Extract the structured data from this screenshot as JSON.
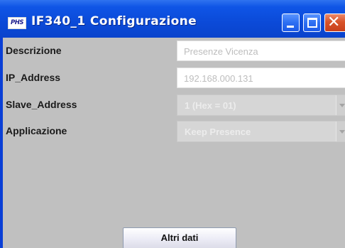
{
  "window": {
    "icon_text": "PHS",
    "title": "IF340_1 Configurazione",
    "buttons": {
      "minimize_icon": "minimize-icon",
      "maximize_icon": "maximize-icon",
      "close_icon": "close-icon",
      "close_glyph": "✕"
    }
  },
  "form": {
    "descrizione": {
      "label": "Descrizione",
      "value": "Presenze Vicenza"
    },
    "ip_address": {
      "label": "IP_Address",
      "value": "192.168.000.131"
    },
    "slave_address": {
      "label": "Slave_Address",
      "value": "1  (Hex = 01)"
    },
    "applicazione": {
      "label": "Applicazione",
      "value": "Keep Presence"
    }
  },
  "actions": {
    "altri_dati": "Altri dati"
  },
  "colors": {
    "titlebar": "#0b4ad8",
    "panel": "#c0c0c0",
    "close_button": "#d8542a",
    "disabled_text": "#bdbdbd"
  }
}
